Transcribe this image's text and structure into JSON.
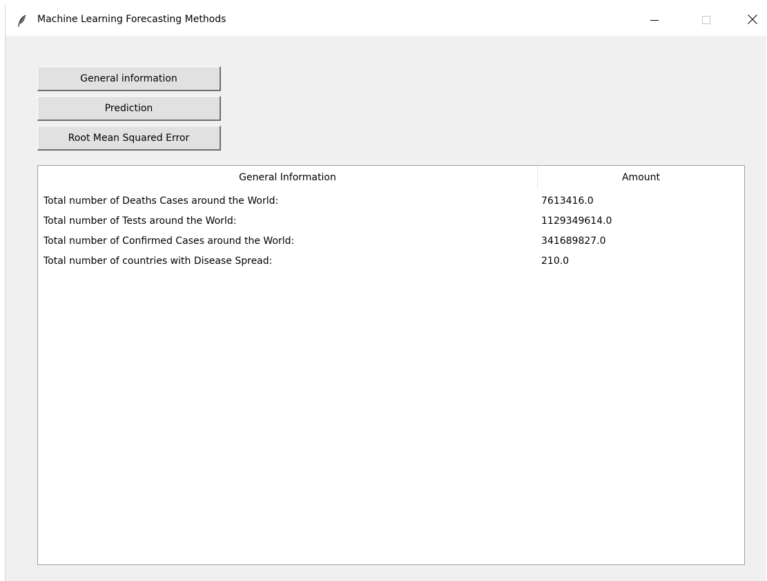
{
  "window": {
    "title": "Machine Learning Forecasting Methods",
    "icons": {
      "app": "feather-icon",
      "minimize": "minimize-icon",
      "maximize": "maximize-icon",
      "close": "close-icon"
    }
  },
  "buttons": {
    "general_information": "General information",
    "prediction": "Prediction",
    "rmse": "Root Mean Squared Error"
  },
  "table": {
    "columns": [
      "General Information",
      "Amount"
    ],
    "rows": [
      {
        "label": "Total number of Deaths Cases around the World:",
        "amount": "7613416.0"
      },
      {
        "label": "Total number of Tests around the World:",
        "amount": "1129349614.0"
      },
      {
        "label": "Total number of Confirmed Cases around the World:",
        "amount": "341689827.0"
      },
      {
        "label": "Total number of countries with Disease Spread:",
        "amount": "210.0"
      }
    ]
  }
}
